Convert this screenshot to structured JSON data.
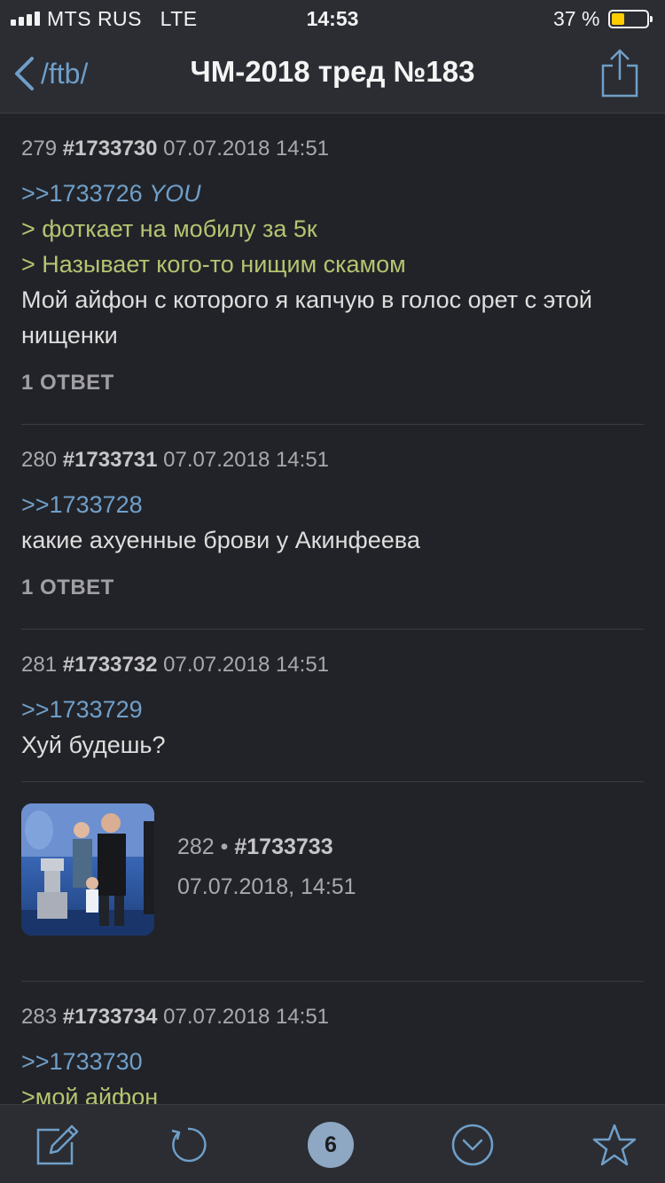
{
  "status": {
    "carrier": "MTS RUS   LTE",
    "time": "14:53",
    "battery": "37 %",
    "battery_level": 0.37
  },
  "nav": {
    "back_label": "/ftb/",
    "title": "ЧМ-2018 тред №183"
  },
  "posts": [
    {
      "num": "279",
      "id": "#1733730",
      "date": "07.07.2018 14:51",
      "reply": ">>1733726",
      "you": "YOU",
      "greentext": [
        "> фоткает на мобилу за 5к",
        "> Называет кого-то нищим скамом"
      ],
      "text": "Мой айфон с которого я капчую в голос орет с этой нищенки",
      "answers": "1 ОТВЕТ"
    },
    {
      "num": "280",
      "id": "#1733731",
      "date": "07.07.2018 14:51",
      "reply": ">>1733728",
      "text": "какие ахуенные брови у Акинфеева",
      "answers": "1 ОТВЕТ"
    },
    {
      "num": "281",
      "id": "#1733732",
      "date": "07.07.2018 14:51",
      "reply": ">>1733729",
      "text": "Хуй будешь?"
    },
    {
      "num": "282 •",
      "id": "#1733733",
      "date": "07.07.2018, 14:51"
    },
    {
      "num": "283",
      "id": "#1733734",
      "date": "07.07.2018 14:51",
      "reply": ">>1733730",
      "greentext": [
        ">мой айфон"
      ]
    }
  ],
  "bottom": {
    "count": "6"
  },
  "icons": {
    "back": "chevron-left-icon",
    "share": "share-icon",
    "compose": "compose-icon",
    "refresh": "refresh-icon",
    "scroll_down": "chevron-down-circle-icon",
    "favorite": "star-icon"
  },
  "colors": {
    "background": "#222328",
    "bar": "#2b2d33",
    "link": "#6f9fc9",
    "greentext": "#b4c471",
    "badge": "#8ea7c3"
  }
}
